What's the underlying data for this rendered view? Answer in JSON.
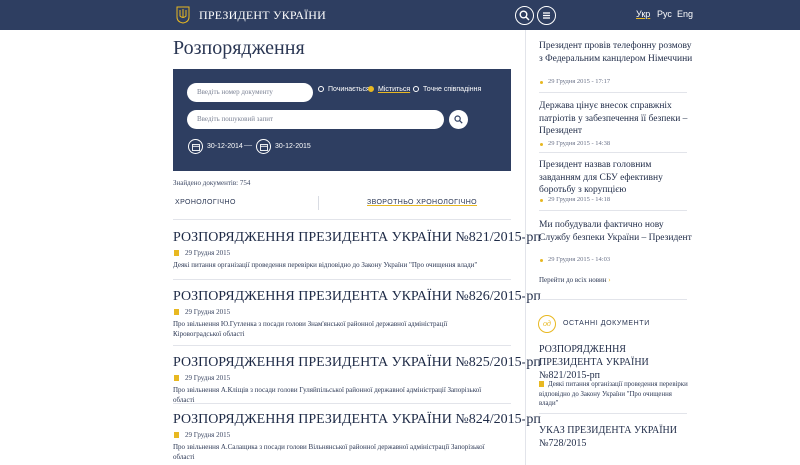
{
  "header": {
    "site_title": "ПРЕЗИДЕНТ УКРАЇНИ",
    "languages": [
      "Укр",
      "Рус",
      "Eng"
    ],
    "active_language": "Укр"
  },
  "main": {
    "title": "Розпорядження",
    "search": {
      "number_placeholder": "Введіть номер документу",
      "match_options": [
        "Починається",
        "Міститься",
        "Точне співпадіння"
      ],
      "selected_option": "Міститься",
      "query_placeholder": "Введіть пошуковий запит",
      "date_from": "30-12-2014",
      "date_separator": "—",
      "date_to": "30-12-2015"
    },
    "found_text": "Знайдено документів: 754",
    "sort_tabs": [
      "ХРОНОЛОГІЧНО",
      "ЗВОРОТНЬО ХРОНОЛОГІЧНО"
    ],
    "active_sort": "ЗВОРОТНЬО ХРОНОЛОГІЧНО",
    "documents": [
      {
        "title": "РОЗПОРЯДЖЕННЯ ПРЕЗИДЕНТА УКРАЇНИ №821/2015-рп",
        "date": "29 Грудня 2015",
        "desc": "Деякі питання організації проведення перевірки відповідно до Закону України \"Про очищення влади\""
      },
      {
        "title": "РОЗПОРЯДЖЕННЯ ПРЕЗИДЕНТА УКРАЇНИ №826/2015-рп",
        "date": "29 Грудня 2015",
        "desc": "Про звільнення Ю.Гутленка з посади голови Знам'янської районної державної адміністрації Кіровоградської області"
      },
      {
        "title": "РОЗПОРЯДЖЕННЯ ПРЕЗИДЕНТА УКРАЇНИ №825/2015-рп",
        "date": "29 Грудня 2015",
        "desc": "Про звільнення А.Кліщів з посади голови Гуляйпільської районної державної адміністрації Запорізької області"
      },
      {
        "title": "РОЗПОРЯДЖЕННЯ ПРЕЗИДЕНТА УКРАЇНИ №824/2015-рп",
        "date": "29 Грудня 2015",
        "desc": "Про звільнення А.Салащика з посади голови Вільнянської районної державної адміністрації Запорізької області"
      }
    ]
  },
  "sidebar": {
    "news": [
      {
        "title": "Президент провів телефонну розмову з Федеральним канцлером Німеччини",
        "date": "29 Грудня 2015 - 17:17"
      },
      {
        "title": "Держава цінує внесок справжніх патріотів у забезпечення її безпеки – Президент",
        "date": "29 Грудня 2015 - 14:38"
      },
      {
        "title": "Президент назвав головним завданням для СБУ ефективну боротьбу з корупцією",
        "date": "29 Грудня 2015 - 14:18"
      },
      {
        "title": "Ми побудували фактично нову Службу безпеки України – Президент",
        "date": "29 Грудня 2015 - 14:03"
      }
    ],
    "all_news_label": "Перейти до всіх новин",
    "docs_badge": "од",
    "docs_heading": "ОСТАННІ ДОКУМЕНТИ",
    "docs": [
      {
        "title": "РОЗПОРЯДЖЕННЯ ПРЕЗИДЕНТА УКРАЇНИ №821/2015-рп",
        "desc": "Деякі питання організації проведення перевірки відповідно до Закону України \"Про очищення влади\""
      },
      {
        "title": "УКАЗ ПРЕЗИДЕНТА УКРАЇНИ №728/2015",
        "desc": ""
      }
    ]
  },
  "colors": {
    "navy": "#2e3e61",
    "accent": "#e8b821"
  }
}
